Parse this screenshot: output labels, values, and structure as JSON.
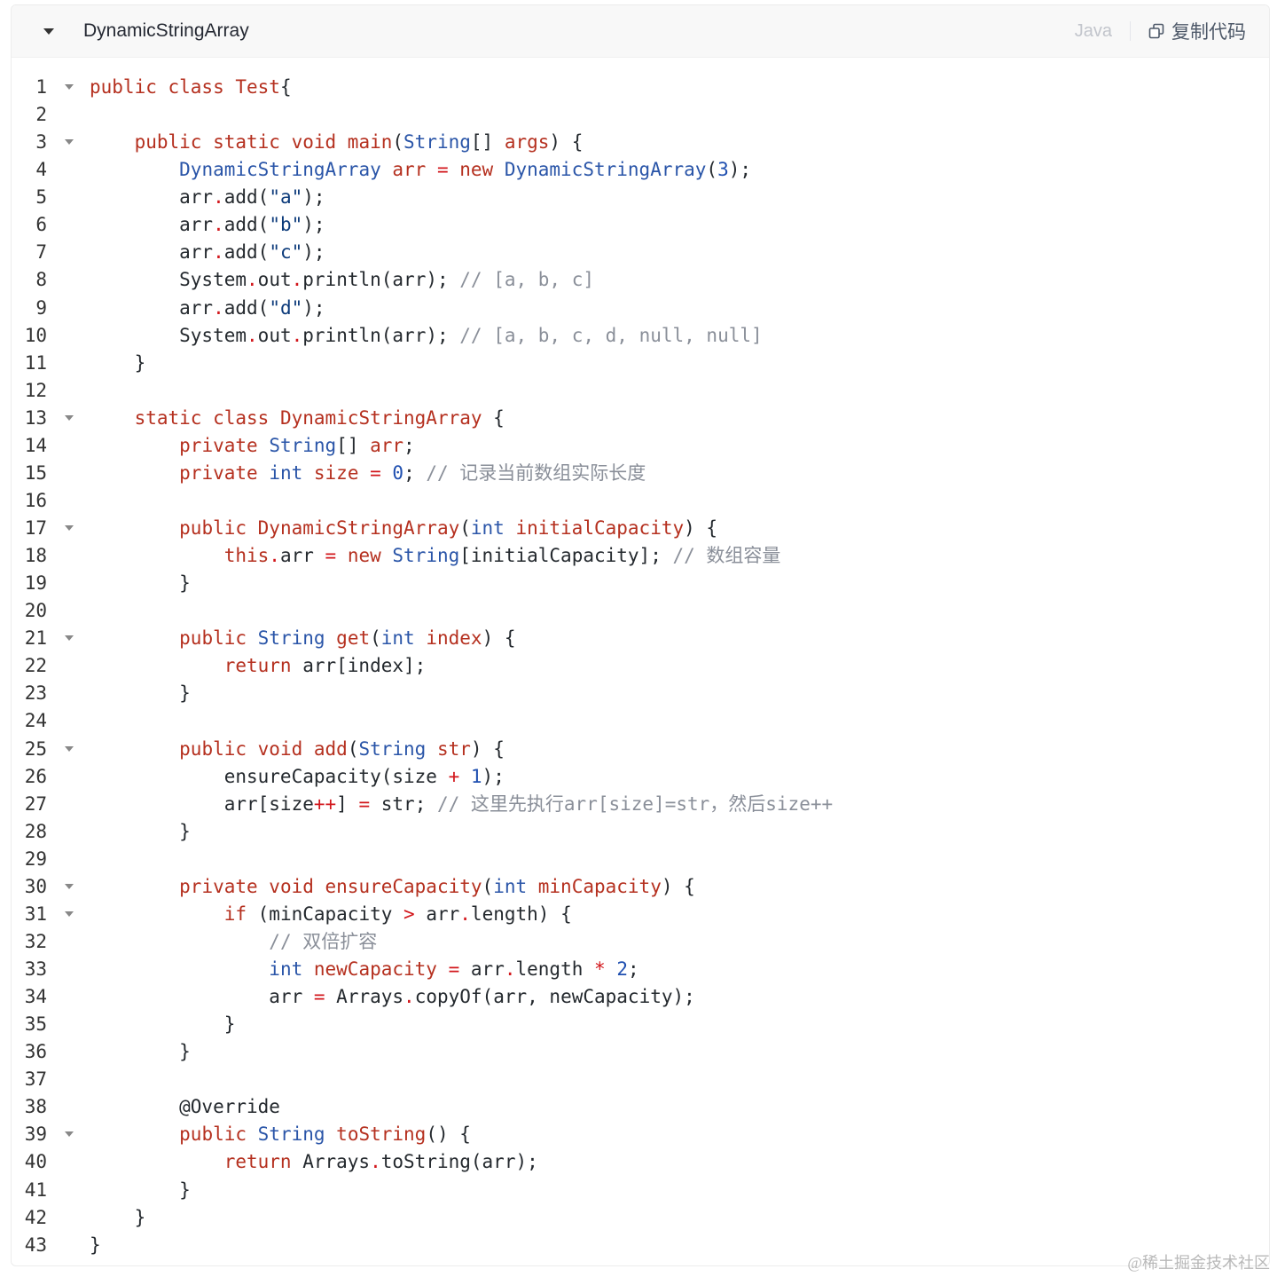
{
  "header": {
    "title": "DynamicStringArray",
    "language": "Java",
    "copy_label": "复制代码"
  },
  "colors": {
    "keyword": "#b5301f",
    "type": "#2a55a8",
    "string": "#0b3a7a",
    "comment": "#8a8f99",
    "number": "#1f4fb0",
    "operator": "#d2161b",
    "text": "#24292e"
  },
  "code_lines": [
    [
      [
        "k",
        "public class Test"
      ],
      [
        "",
        "{"
      ]
    ],
    [],
    [
      [
        "",
        "    "
      ],
      [
        "k",
        "public static void main"
      ],
      [
        "",
        "("
      ],
      [
        "t",
        "String"
      ],
      [
        "",
        "[] "
      ],
      [
        "k",
        "args"
      ],
      [
        "",
        ") {"
      ]
    ],
    [
      [
        "",
        "        "
      ],
      [
        "t",
        "DynamicStringArray"
      ],
      [
        "k",
        " arr "
      ],
      [
        "o",
        "="
      ],
      [
        "k",
        " new "
      ],
      [
        "t",
        "DynamicStringArray"
      ],
      [
        "",
        "("
      ],
      [
        "n",
        "3"
      ],
      [
        "",
        ");"
      ]
    ],
    [
      [
        "",
        "        arr"
      ],
      [
        "o",
        "."
      ],
      [
        "",
        "add("
      ],
      [
        "s",
        "\"a\""
      ],
      [
        "",
        ");"
      ]
    ],
    [
      [
        "",
        "        arr"
      ],
      [
        "o",
        "."
      ],
      [
        "",
        "add("
      ],
      [
        "s",
        "\"b\""
      ],
      [
        "",
        ");"
      ]
    ],
    [
      [
        "",
        "        arr"
      ],
      [
        "o",
        "."
      ],
      [
        "",
        "add("
      ],
      [
        "s",
        "\"c\""
      ],
      [
        "",
        ");"
      ]
    ],
    [
      [
        "",
        "        System"
      ],
      [
        "o",
        "."
      ],
      [
        "",
        "out"
      ],
      [
        "o",
        "."
      ],
      [
        "",
        "println(arr); "
      ],
      [
        "c",
        "// [a, b, c]"
      ]
    ],
    [
      [
        "",
        "        arr"
      ],
      [
        "o",
        "."
      ],
      [
        "",
        "add("
      ],
      [
        "s",
        "\"d\""
      ],
      [
        "",
        ");"
      ]
    ],
    [
      [
        "",
        "        System"
      ],
      [
        "o",
        "."
      ],
      [
        "",
        "out"
      ],
      [
        "o",
        "."
      ],
      [
        "",
        "println(arr); "
      ],
      [
        "c",
        "// [a, b, c, d, null, null]"
      ]
    ],
    [
      [
        "",
        "    }"
      ]
    ],
    [],
    [
      [
        "",
        "    "
      ],
      [
        "k",
        "static class DynamicStringArray"
      ],
      [
        "",
        " {"
      ]
    ],
    [
      [
        "",
        "        "
      ],
      [
        "k",
        "private "
      ],
      [
        "t",
        "String"
      ],
      [
        "",
        "[] "
      ],
      [
        "k",
        "arr"
      ],
      [
        "",
        ";"
      ]
    ],
    [
      [
        "",
        "        "
      ],
      [
        "k",
        "private "
      ],
      [
        "t",
        "int"
      ],
      [
        "k",
        " size "
      ],
      [
        "o",
        "="
      ],
      [
        "",
        " "
      ],
      [
        "n",
        "0"
      ],
      [
        "",
        "; "
      ],
      [
        "c",
        "// 记录当前数组实际长度"
      ]
    ],
    [],
    [
      [
        "",
        "        "
      ],
      [
        "k",
        "public DynamicStringArray"
      ],
      [
        "",
        "("
      ],
      [
        "t",
        "int"
      ],
      [
        "k",
        " initialCapacity"
      ],
      [
        "",
        ") {"
      ]
    ],
    [
      [
        "",
        "            "
      ],
      [
        "k",
        "this"
      ],
      [
        "o",
        "."
      ],
      [
        "",
        "arr "
      ],
      [
        "o",
        "="
      ],
      [
        "k",
        " new "
      ],
      [
        "t",
        "String"
      ],
      [
        "",
        "[initialCapacity]; "
      ],
      [
        "c",
        "// 数组容量"
      ]
    ],
    [
      [
        "",
        "        }"
      ]
    ],
    [],
    [
      [
        "",
        "        "
      ],
      [
        "k",
        "public "
      ],
      [
        "t",
        "String"
      ],
      [
        "k",
        " get"
      ],
      [
        "",
        "("
      ],
      [
        "t",
        "int"
      ],
      [
        "k",
        " index"
      ],
      [
        "",
        ") {"
      ]
    ],
    [
      [
        "",
        "            "
      ],
      [
        "k",
        "return"
      ],
      [
        "",
        " arr[index];"
      ]
    ],
    [
      [
        "",
        "        }"
      ]
    ],
    [],
    [
      [
        "",
        "        "
      ],
      [
        "k",
        "public void add"
      ],
      [
        "",
        "("
      ],
      [
        "t",
        "String"
      ],
      [
        "k",
        " str"
      ],
      [
        "",
        ") {"
      ]
    ],
    [
      [
        "",
        "            ensureCapacity(size "
      ],
      [
        "o",
        "+"
      ],
      [
        "",
        " "
      ],
      [
        "n",
        "1"
      ],
      [
        "",
        ");"
      ]
    ],
    [
      [
        "",
        "            arr[size"
      ],
      [
        "o",
        "++"
      ],
      [
        "",
        "] "
      ],
      [
        "o",
        "="
      ],
      [
        "",
        " str; "
      ],
      [
        "c",
        "// 这里先执行arr[size]=str，然后size++"
      ]
    ],
    [
      [
        "",
        "        }"
      ]
    ],
    [],
    [
      [
        "",
        "        "
      ],
      [
        "k",
        "private void ensureCapacity"
      ],
      [
        "",
        "("
      ],
      [
        "t",
        "int"
      ],
      [
        "k",
        " minCapacity"
      ],
      [
        "",
        ") {"
      ]
    ],
    [
      [
        "",
        "            "
      ],
      [
        "k",
        "if"
      ],
      [
        "",
        " (minCapacity "
      ],
      [
        "o",
        ">"
      ],
      [
        "",
        " arr"
      ],
      [
        "o",
        "."
      ],
      [
        "",
        "length) {"
      ]
    ],
    [
      [
        "",
        "                "
      ],
      [
        "c",
        "// 双倍扩容"
      ]
    ],
    [
      [
        "",
        "                "
      ],
      [
        "t",
        "int"
      ],
      [
        "k",
        " newCapacity "
      ],
      [
        "o",
        "="
      ],
      [
        "",
        " arr"
      ],
      [
        "o",
        "."
      ],
      [
        "",
        "length "
      ],
      [
        "o",
        "*"
      ],
      [
        "",
        " "
      ],
      [
        "n",
        "2"
      ],
      [
        "",
        ";"
      ]
    ],
    [
      [
        "",
        "                arr "
      ],
      [
        "o",
        "="
      ],
      [
        "",
        " Arrays"
      ],
      [
        "o",
        "."
      ],
      [
        "",
        "copyOf(arr, newCapacity);"
      ]
    ],
    [
      [
        "",
        "            }"
      ]
    ],
    [
      [
        "",
        "        }"
      ]
    ],
    [],
    [
      [
        "",
        "        @Override"
      ]
    ],
    [
      [
        "",
        "        "
      ],
      [
        "k",
        "public "
      ],
      [
        "t",
        "String"
      ],
      [
        "k",
        " toString"
      ],
      [
        "",
        "() {"
      ]
    ],
    [
      [
        "",
        "            "
      ],
      [
        "k",
        "return"
      ],
      [
        "",
        " Arrays"
      ],
      [
        "o",
        "."
      ],
      [
        "",
        "toString(arr);"
      ]
    ],
    [
      [
        "",
        "        }"
      ]
    ],
    [
      [
        "",
        "    }"
      ]
    ],
    [
      [
        "",
        "}"
      ]
    ]
  ],
  "foldable_lines": [
    1,
    3,
    13,
    17,
    21,
    25,
    30,
    31,
    39
  ],
  "watermark": "@稀土掘金技术社区"
}
